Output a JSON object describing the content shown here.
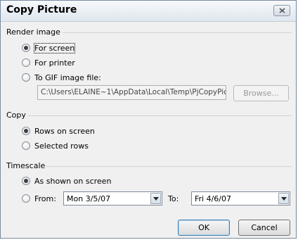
{
  "dialog": {
    "title": "Copy Picture",
    "close_icon": "close-icon"
  },
  "render_image": {
    "group_label": "Render image",
    "options": [
      {
        "label": "For screen",
        "checked": true
      },
      {
        "label": "For printer",
        "checked": false
      },
      {
        "label": "To GIF image file:",
        "checked": false
      }
    ],
    "file_path": "C:\\Users\\ELAINE~1\\AppData\\Local\\Temp\\PjCopyPic",
    "browse_label": "Browse..."
  },
  "copy": {
    "group_label": "Copy",
    "options": [
      {
        "label": "Rows on screen",
        "checked": true
      },
      {
        "label": "Selected rows",
        "checked": false
      }
    ]
  },
  "timescale": {
    "group_label": "Timescale",
    "options": [
      {
        "label": "As shown on screen",
        "checked": true
      },
      {
        "label": "From:",
        "checked": false
      }
    ],
    "from_value": "Mon 3/5/07",
    "to_label": "To:",
    "to_value": "Fri 4/6/07"
  },
  "buttons": {
    "ok": "OK",
    "cancel": "Cancel"
  }
}
